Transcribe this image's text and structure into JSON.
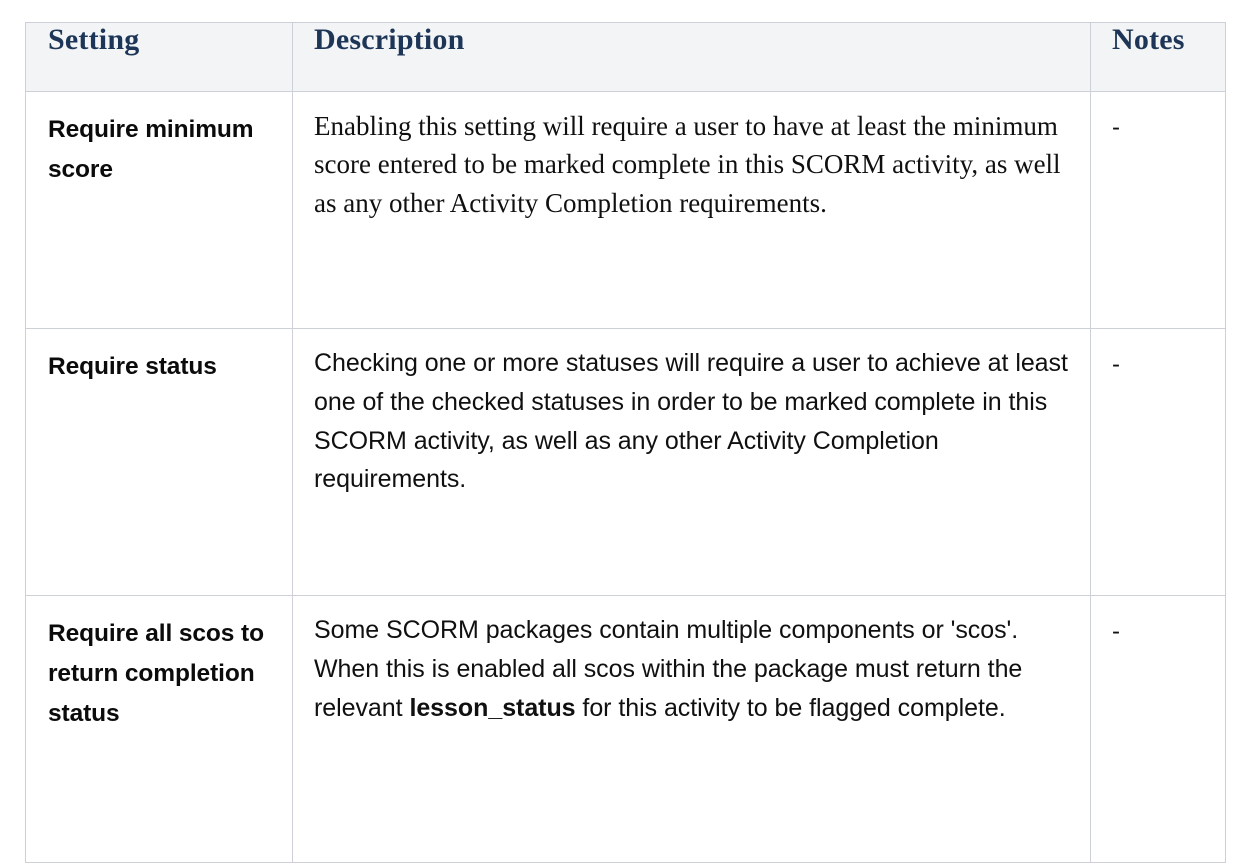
{
  "table": {
    "columns": [
      {
        "key": "setting",
        "label": "Setting"
      },
      {
        "key": "description",
        "label": "Description"
      },
      {
        "key": "notes",
        "label": "Notes"
      }
    ],
    "header_bg": "#f2f4f6",
    "header_text_color": "#1d3557",
    "border_color": "#cdd0d6",
    "rows": [
      {
        "setting": "Require minimum score",
        "description": "Enabling this setting will require a user to have at least the minimum score entered to be marked complete in this SCORM activity, as well as any other Activity Completion requirements.",
        "description_html": "Enabling this setting will require a user to have at least the minimum score entered to be marked complete in this SCORM activity, as well as any other Activity Completion requirements.",
        "description_font": "serif",
        "notes": "-"
      },
      {
        "setting": "Require status",
        "description": "Checking one or more statuses will require a user to achieve at least one of the checked statuses in order to be marked complete in this SCORM activity, as well as any other Activity Completion requirements.",
        "description_html": "Checking one or more statuses will require a user to achieve at least one of the checked statuses in order to be marked complete in this SCORM activity, as well as any other Activity Completion requirements.",
        "description_font": "sans",
        "notes": "-"
      },
      {
        "setting": "Require all scos to return completion status",
        "description": "Some SCORM packages contain multiple components or 'scos'. When this is enabled all scos within the package must return the relevant lesson_status for this activity to be flagged complete.",
        "description_html": "Some SCORM packages contain multiple components or 'scos'. When this is enabled all scos within the package must return the relevant <b>lesson_status</b> for this activity to be flagged complete.",
        "description_font": "sans",
        "notes": "-"
      }
    ]
  }
}
